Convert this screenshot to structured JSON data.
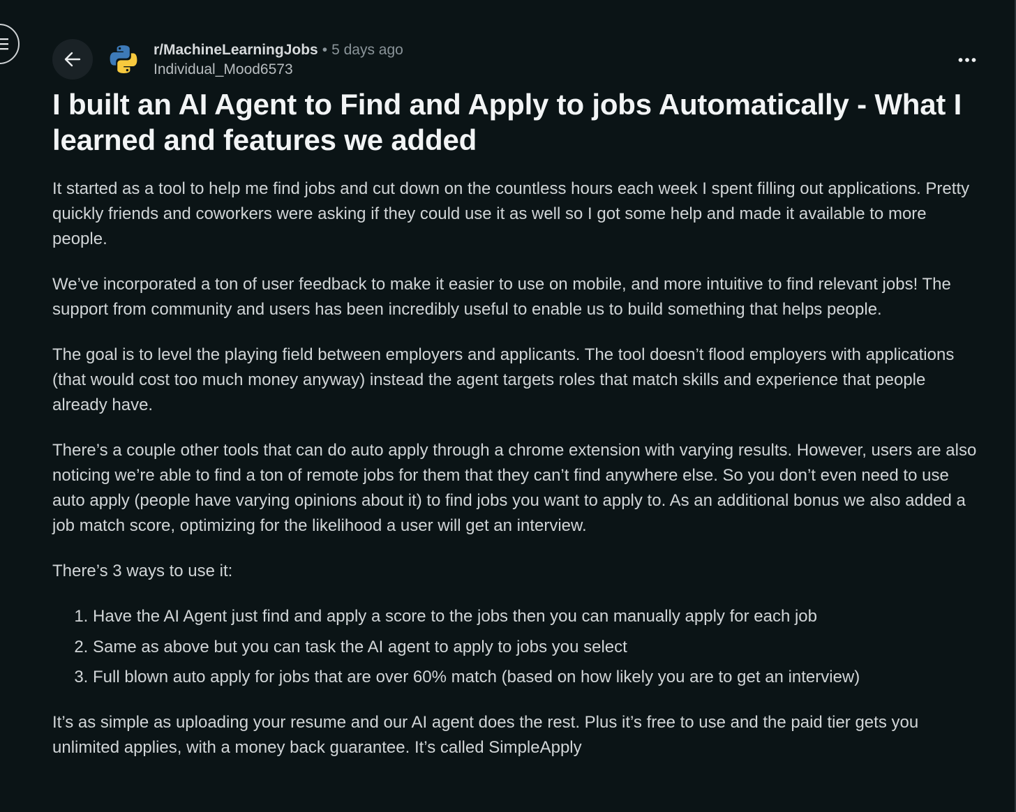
{
  "header": {
    "subreddit": "r/MachineLearningJobs",
    "separator": "•",
    "time_ago": "5 days ago",
    "author": "Individual_Mood6573"
  },
  "post": {
    "title": "I built an AI Agent to Find and Apply to jobs Automatically - What I learned and features we added",
    "paragraphs": [
      "It started as a tool to help me find jobs and cut down on the countless hours each week I spent filling out applications. Pretty quickly friends and coworkers were asking if they could use it as well so I got some help and made it available to more people.",
      "We’ve incorporated a ton of user feedback to make it easier to use on mobile, and more intuitive to find relevant jobs! The support from community and users has been incredibly useful to enable us to build something that helps people.",
      "The goal is to level the playing field between employers and applicants. The tool doesn’t flood employers with applications (that would cost too much money anyway) instead the agent targets roles that match skills and experience that people already have.",
      "There’s a couple other tools that can do auto apply through a chrome extension with varying results. However, users are also noticing we’re able to find a ton of remote jobs for them that they can’t find anywhere else. So you don’t even need to use auto apply (people have varying opinions about it) to find jobs you want to apply to. As an additional bonus we also added a job match score, optimizing for the likelihood a user will get an interview.",
      "There’s 3 ways to use it:"
    ],
    "list_items": [
      "Have the AI Agent just find and apply a score to the jobs then you can manually apply for each job",
      "Same as above but you can task the AI agent to apply to jobs you select",
      "Full blown auto apply for jobs that are over 60% match (based on how likely you are to get an interview)"
    ],
    "closing": "It’s as simple as uploading your resume and our AI agent does the rest. Plus it’s free to use and the paid tier gets you unlimited applies, with a money back guarantee. It’s called SimpleApply"
  },
  "icons": {
    "menu": "menu-icon",
    "back": "arrow-left-icon",
    "subreddit": "python-logo-icon",
    "more": "more-horizontal-icon"
  },
  "colors": {
    "background": "#0b1416",
    "button_bg": "#1a2226",
    "text_primary": "#f2f4f5",
    "text_body": "#d1d5d7",
    "text_muted": "#8a9499",
    "python_blue": "#3d7ab8",
    "python_yellow": "#f7c93e"
  }
}
